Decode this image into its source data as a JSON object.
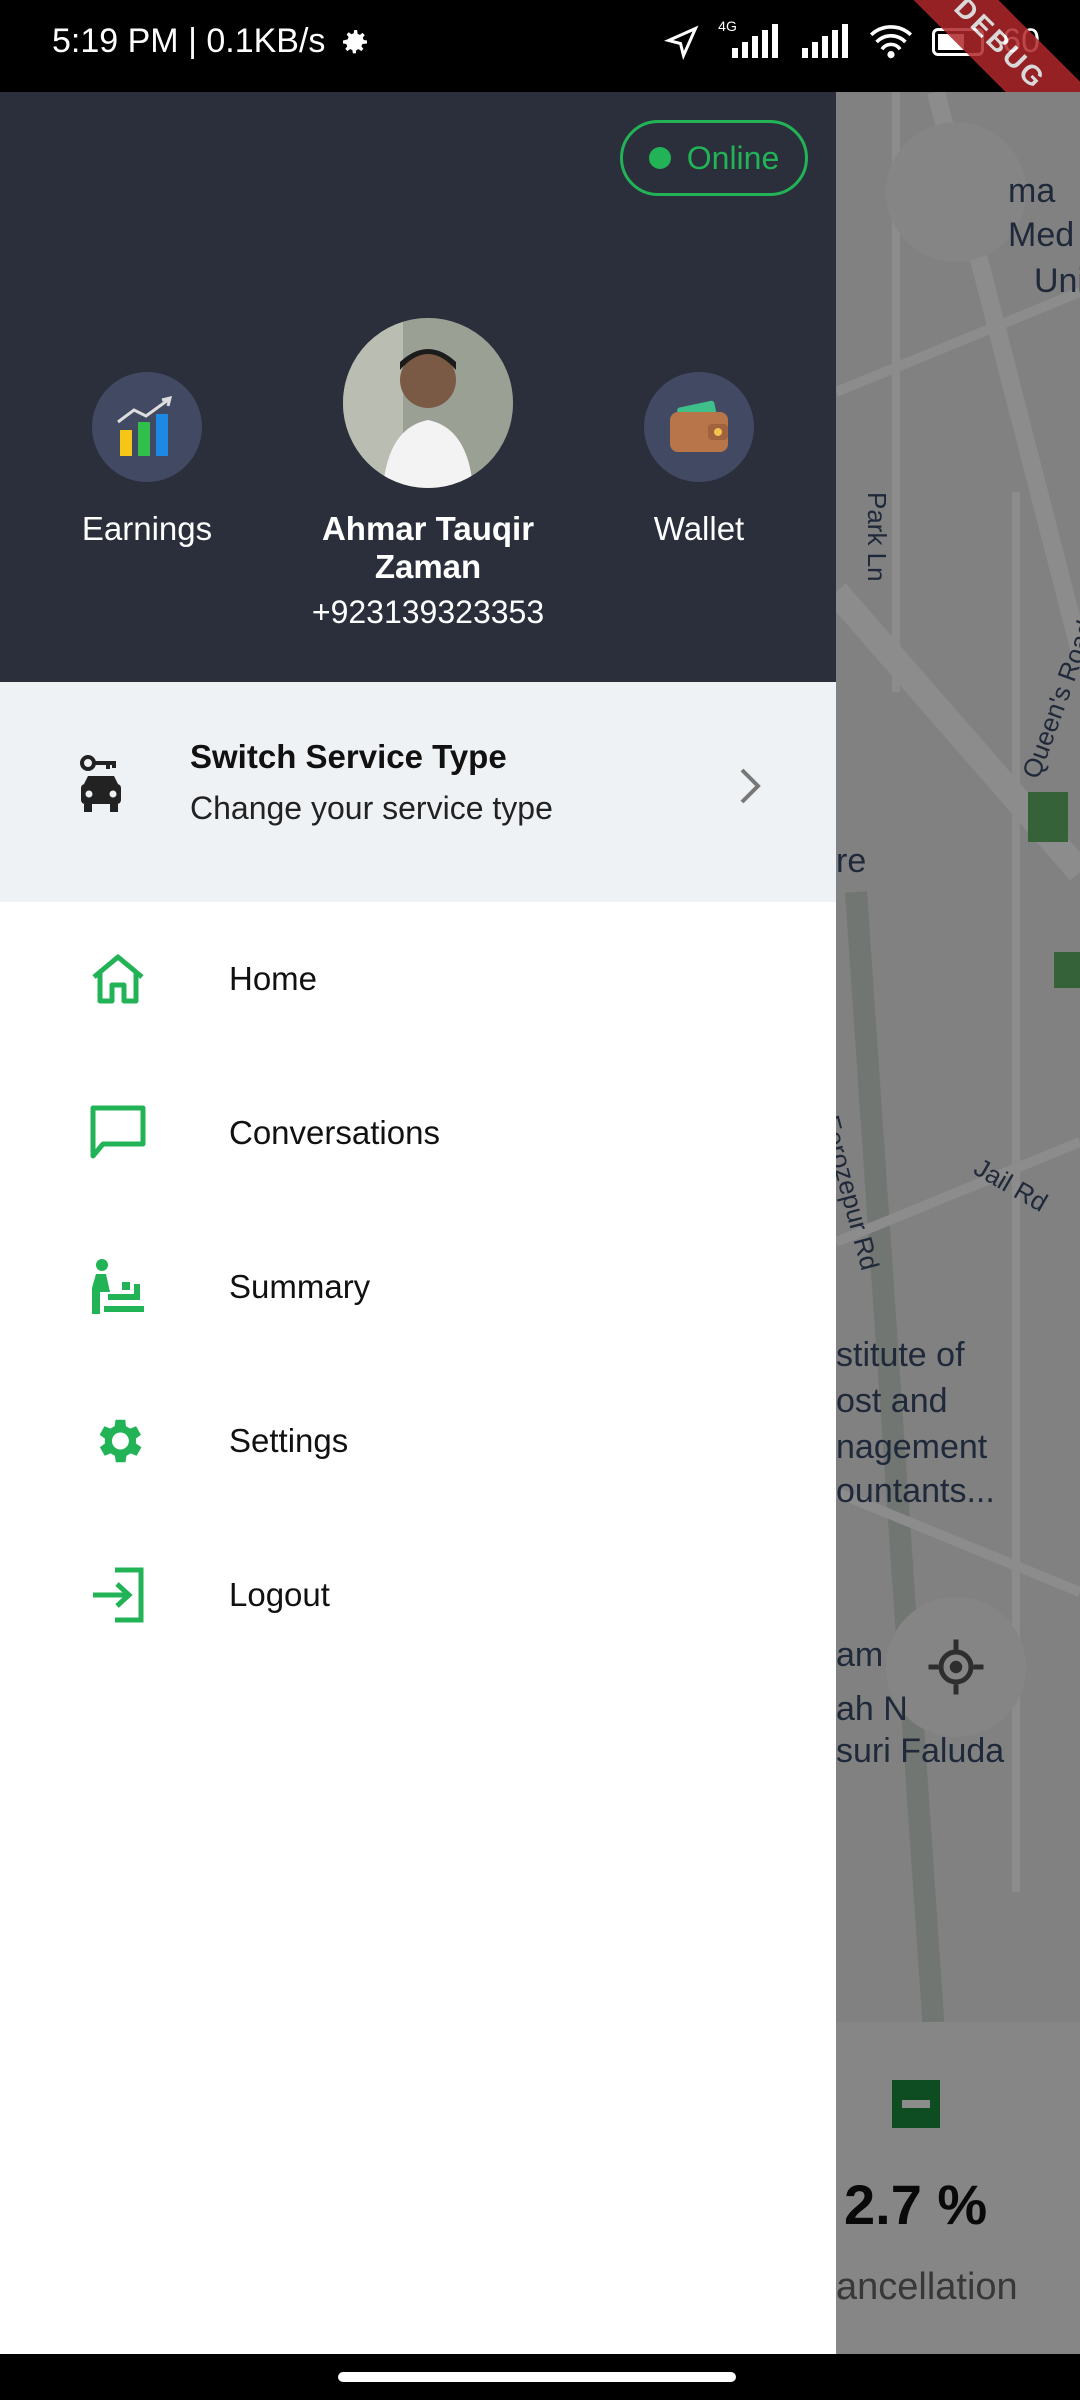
{
  "status": {
    "time_speed": "5:19 PM | 0.1KB/s",
    "network": "4G",
    "battery": "60",
    "debug": "DEBUG"
  },
  "map": {
    "labels": [
      "ma",
      "Med",
      "Univ",
      "Park Ln",
      "Queen's Road",
      "re",
      "Ferozepur Rd",
      "Jail Rd",
      "stitute of",
      "ost and",
      "nagement",
      "ountants...",
      "am",
      "ah N",
      "suri Faluda"
    ],
    "stat_value": "2.7 %",
    "stat_label": "ancellation"
  },
  "header": {
    "status_label": "Online",
    "earnings_label": "Earnings",
    "wallet_label": "Wallet",
    "user_name": "Ahmar Tauqir Zaman",
    "user_phone": "+923139323353"
  },
  "switch_service": {
    "title": "Switch Service Type",
    "subtitle": "Change your service type"
  },
  "menu": [
    {
      "label": "Home",
      "icon": "home-icon"
    },
    {
      "label": "Conversations",
      "icon": "chat-icon"
    },
    {
      "label": "Summary",
      "icon": "summary-icon"
    },
    {
      "label": "Settings",
      "icon": "settings-icon"
    },
    {
      "label": "Logout",
      "icon": "logout-icon"
    }
  ],
  "colors": {
    "accent": "#22b357",
    "header_bg": "#2a2f3b",
    "switch_bg": "#eff2f5"
  }
}
